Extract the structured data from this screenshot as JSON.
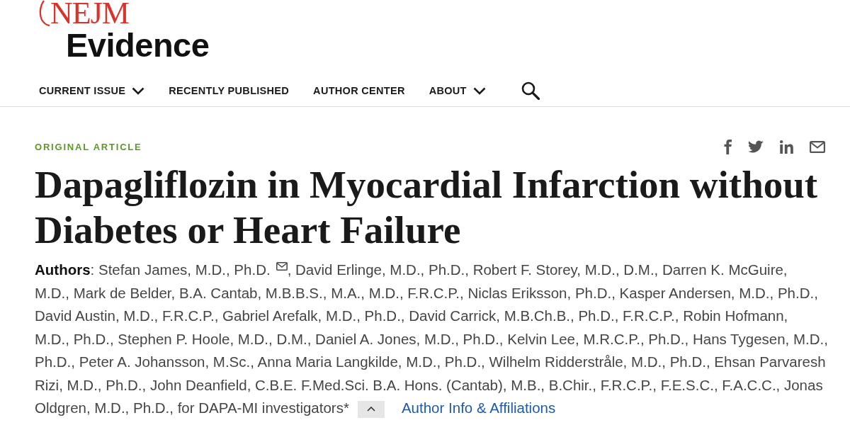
{
  "logo": {
    "brand": "NEJM",
    "name": "Evidence"
  },
  "nav": {
    "items": [
      {
        "label": "CURRENT ISSUE",
        "dropdown": true
      },
      {
        "label": "RECENTLY PUBLISHED",
        "dropdown": false
      },
      {
        "label": "AUTHOR CENTER",
        "dropdown": false
      },
      {
        "label": "ABOUT",
        "dropdown": true
      }
    ]
  },
  "article": {
    "category": "ORIGINAL ARTICLE",
    "title": "Dapagliflozin in Myocardial Infarction without Diabetes or Heart Failure",
    "authors": {
      "lead": "**Authors**: Stefan James, M.D., Ph.D.",
      "after_mail": ", David Erlinge, M.D., Ph.D., Robert F. Storey, M.D., D.M., Darren K. McGuire,",
      "body": "M.D., Mark de Belder, B.A. Cantab, M.B.B.S., M.A., M.D., F.R.C.P., Niclas Eriksson, Ph.D., Kasper Andersen, M.D., Ph.D.,\nDavid Austin, M.D., F.R.C.P., Gabriel Arefalk, M.D., Ph.D., David Carrick, M.B.Ch.B., Ph.D., F.R.C.P., Robin Hofmann,\nM.D., Ph.D., Stephen P. Hoole, M.D., D.M., Daniel A. Jones, M.D., Ph.D., Kelvin Lee, M.R.C.P., Ph.D., Hans Tygesen, M.D.,\nPh.D., Peter A. Johansson, M.Sc., Anna Maria Langkilde, M.D., Ph.D., Wilhelm Ridderstråle, M.D., Ph.D., Ehsan Parvaresh\nRizi, M.D., Ph.D., John Deanfield, C.B.E. F.Med.Sci. B.A. Hons. (Cantab), M.B., B.Chir., F.R.C.P., F.E.S.C., F.A.C.C., Jonas",
      "tail": "Oldgren, M.D., Ph.D., for DAPA-MI investigators*",
      "link": "Author Info & Affiliations"
    }
  }
}
